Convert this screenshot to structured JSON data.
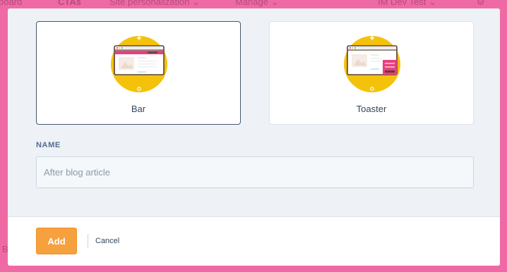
{
  "background_nav": {
    "items": [
      {
        "label": "board"
      },
      {
        "label": "CTAs"
      },
      {
        "label": "Site personalization ⌄"
      },
      {
        "label": "Manage ⌄"
      },
      {
        "label": "IM Dev Test ⌄"
      }
    ],
    "bottom_fragment": "B"
  },
  "modal": {
    "cards": [
      {
        "label": "Bar",
        "icon": "bar-illustration-icon",
        "selected": true
      },
      {
        "label": "Toaster",
        "icon": "toaster-illustration-icon",
        "selected": false
      }
    ],
    "name_field": {
      "label": "NAME",
      "value": "",
      "placeholder": "After blog article"
    },
    "footer": {
      "add_label": "Add",
      "cancel_label": "Cancel"
    }
  },
  "colors": {
    "backdrop": "#ef6aa4",
    "accent_orange": "#f7a03e",
    "icon_yellow": "#f5c20b",
    "bar_pink": "#e8407f",
    "text_dark": "#33475b"
  }
}
